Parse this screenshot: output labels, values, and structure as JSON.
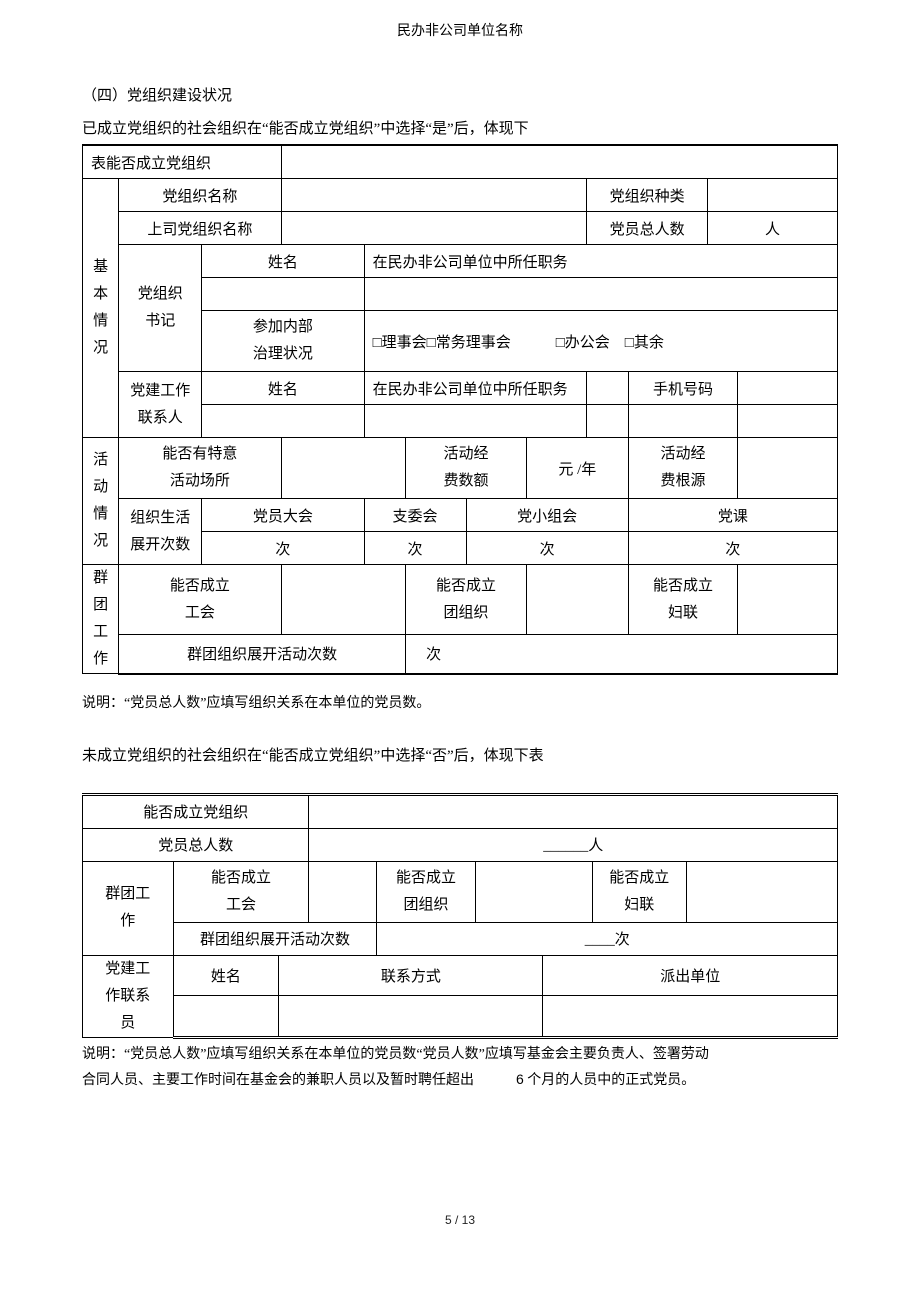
{
  "header": {
    "title": "民办非公司单位名称"
  },
  "section4": {
    "heading": "（四）党组织建设状况",
    "lead1": "已成立党组织的社会组织在“能否成立党组织”中选择“是”后，体现下",
    "t1": {
      "biao": "表",
      "canEstablish": "能否成立党组织",
      "basic": "基\n本\n情\n况",
      "orgNameLbl": "党组织名称",
      "orgTypeLbl": "党组织种类",
      "superiorLbl": "上司党组织名称",
      "totalMembersLbl": "党员总人数",
      "personUnit": "人",
      "secretary": "党组织\n书记",
      "name": "姓名",
      "position": "在民办非公司单位中所任职务",
      "attend": "参加内部\n治理状况",
      "checkboxes": "□理事会□常务理事会   □办公会 □其余",
      "contact": "党建工作\n联系人",
      "phoneLbl": "手机号码",
      "activity": "活\n动\n情\n况",
      "placeLbl": "能否有特意\n活动场所",
      "feeLbl": "活动经\n费数额",
      "feeUnit": "元 /年",
      "feeSourceLbl": "活动经\n费根源",
      "lifeLbl": "组织生活\n展开次数",
      "memberMeeting": "党员大会",
      "branchMeeting": "支委会",
      "groupMeeting": "党小组会",
      "lecture": "党课",
      "times": "次",
      "group": "群团工\n作",
      "unionLbl": "能否成立\n工会",
      "youthLbl": "能否成立\n团组织",
      "womenLbl": "能否成立\n妇联",
      "groupTimes": "群团组织展开活动次数",
      "groupTimesVal": "次"
    },
    "note1": "说明：“党员总人数”应填写组织关系在本单位的党员数。",
    "lead2": "未成立党组织的社会组织在“能否成立党组织”中选择“否”后，体现下表",
    "t2": {
      "canEstablish": "能否成立党组织",
      "totalMembersLbl": "党员总人数",
      "totalMembersVal": "______人",
      "group": "群团工\n作",
      "unionLbl": "能否成立\n工会",
      "youthLbl": "能否成立\n团组织",
      "womenLbl": "能否成立\n妇联",
      "groupTimes": "群团组织展开活动次数",
      "groupTimesVal": "____次",
      "contact": "党建工\n作联系\n员",
      "name": "姓名",
      "contactWay": "联系方式",
      "dispatch": "派出单位"
    },
    "note2a": "说明：“党员总人数”应填写组织关系在本单位的党员数“党员人数”应填写基金会主要负责人、签署劳动",
    "note2b_pre": "合同人员、主要工作时间在基金会的兼职人员以及暂时聘任超出   ",
    "note2b_6": "6",
    "note2b_post": " 个月的人员中的正式党员。"
  },
  "footer": {
    "page": "5 / 13"
  }
}
